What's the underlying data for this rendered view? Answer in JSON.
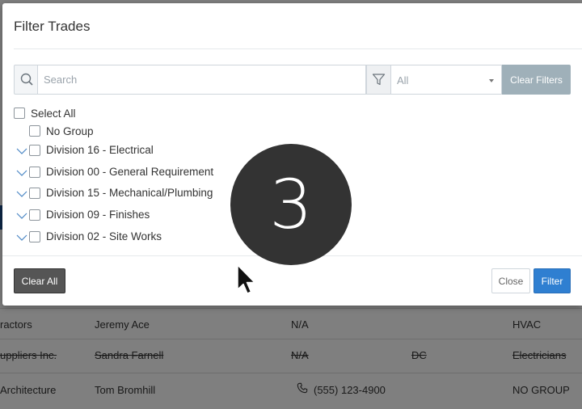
{
  "background_table": {
    "rows": [
      {
        "company": "ractors",
        "contact": "Jeremy Ace",
        "phone": "N/A",
        "state": "",
        "trade": "HVAC",
        "struck": false
      },
      {
        "company": "uppliers Inc.",
        "contact": "Sandra Farnell",
        "phone": "N/A",
        "state": "DC",
        "trade": "Electricians",
        "struck": true
      },
      {
        "company": "Architecture",
        "contact": "Tom Bromhill",
        "phone": "(555) 123-4900",
        "state": "",
        "trade": "NO GROUP",
        "struck": false,
        "phone_icon": "phone-icon"
      }
    ]
  },
  "modal": {
    "title": "Filter Trades",
    "search": {
      "placeholder": "Search",
      "value": "",
      "icon": "search-icon"
    },
    "filter_icon": "funnel-icon",
    "group_select": {
      "value": "All"
    },
    "clear_filters_label": "Clear Filters",
    "select_all_label": "Select All",
    "items": [
      {
        "label": "No Group",
        "expandable": false,
        "checked": false
      },
      {
        "label": "Division 16 - Electrical",
        "expandable": true,
        "checked": false
      },
      {
        "label": "Division 00 - General Requirement",
        "expandable": true,
        "checked": false
      },
      {
        "label": "Division 15 - Mechanical/Plumbing",
        "expandable": true,
        "checked": false
      },
      {
        "label": "Division 09 - Finishes",
        "expandable": true,
        "checked": false
      },
      {
        "label": "Division 02 - Site Works",
        "expandable": true,
        "checked": false
      }
    ],
    "footer": {
      "clear_all_label": "Clear All",
      "close_label": "Close",
      "filter_label": "Filter"
    }
  },
  "step_badge": {
    "number": "3"
  },
  "colors": {
    "primary": "#2f7fd1",
    "clear_filters": "#9fb0b9",
    "clear_all": "#555555",
    "badge": "#333333"
  }
}
